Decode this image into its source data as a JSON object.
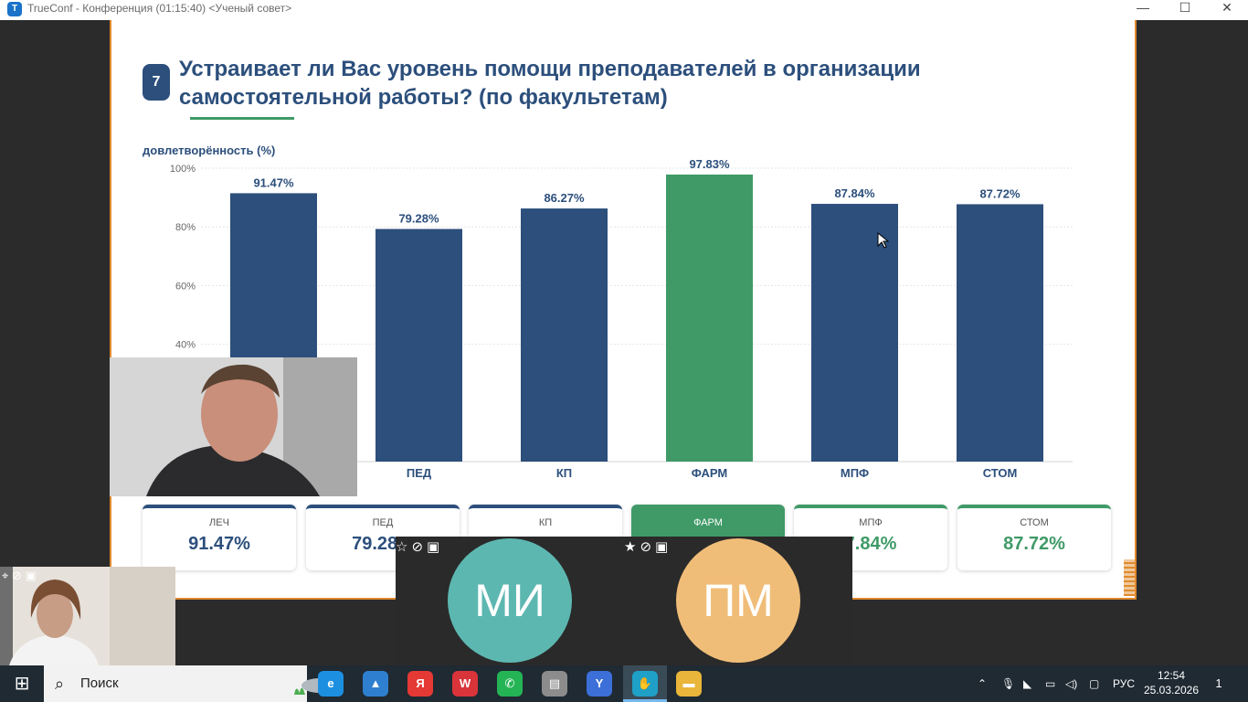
{
  "window": {
    "title": "TrueConf - Конференция (01:15:40) <Ученый совет>",
    "app_icon": "trueconf-icon",
    "controls": {
      "minimize": "—",
      "maximize": "☐",
      "close": "✕"
    }
  },
  "slide": {
    "question_number": "7",
    "title_line1": "Устраивает ли Вас уровень помощи преподавателей в организации",
    "title_line2": "самостоятельной работы? (по факультетам)",
    "cards": [
      {
        "label": "ЛЕЧ",
        "value": "91.47%"
      },
      {
        "label": "ПЕД",
        "value": "79.28%"
      },
      {
        "label": "КП",
        "value": ""
      },
      {
        "label": "ФАРМ",
        "value": ""
      },
      {
        "label": "МПФ",
        "value": "7.84%"
      },
      {
        "label": "СТОМ",
        "value": "87.72%"
      }
    ]
  },
  "chart_data": {
    "type": "bar",
    "ylabel": "довлетворённость (%)",
    "ylim": [
      0,
      100
    ],
    "yticks": [
      "40%",
      "60%",
      "80%",
      "100%"
    ],
    "grid": true,
    "categories": [
      "",
      "ПЕД",
      "КП",
      "ФАРМ",
      "МПФ",
      "СТОМ"
    ],
    "values": [
      91.47,
      79.28,
      86.27,
      97.83,
      87.84,
      87.72
    ],
    "labels": [
      "91.47%",
      "79.28%",
      "86.27%",
      "97.83%",
      "87.84%",
      "87.72%"
    ],
    "highlight_index": 3,
    "colors": {
      "bar": "#2c4f7c",
      "highlight": "#3f9a67"
    }
  },
  "participants": {
    "mi": {
      "initials": "МИ",
      "color": "#5db7b1"
    },
    "pm": {
      "initials": "ПМ",
      "color": "#f0bd78"
    },
    "tile_icons": [
      "star-icon",
      "mic-off-icon",
      "camera-off-icon"
    ]
  },
  "taskbar": {
    "search_placeholder": "Поиск",
    "apps": [
      {
        "name": "edge-icon",
        "glyph": "e",
        "color": "#1d8fe0"
      },
      {
        "name": "photos-icon",
        "glyph": "▲",
        "color": "#2f7fd0"
      },
      {
        "name": "yandex-icon",
        "glyph": "Я",
        "color": "#e53935"
      },
      {
        "name": "wps-icon",
        "glyph": "W",
        "color": "#d9343a"
      },
      {
        "name": "whatsapp-icon",
        "glyph": "✆",
        "color": "#25b455"
      },
      {
        "name": "scanner-icon",
        "glyph": "▤",
        "color": "#8c8c8c"
      },
      {
        "name": "yandex-browser-icon",
        "glyph": "Y",
        "color": "#3c6fd8"
      },
      {
        "name": "trueconf-taskbar-icon",
        "glyph": "✋",
        "color": "#1fa0c6"
      },
      {
        "name": "explorer-icon",
        "glyph": "▬",
        "color": "#e9b53a"
      }
    ],
    "language": "РУС",
    "time": "12:54",
    "date": "25.03.2026",
    "notifications": "1"
  }
}
